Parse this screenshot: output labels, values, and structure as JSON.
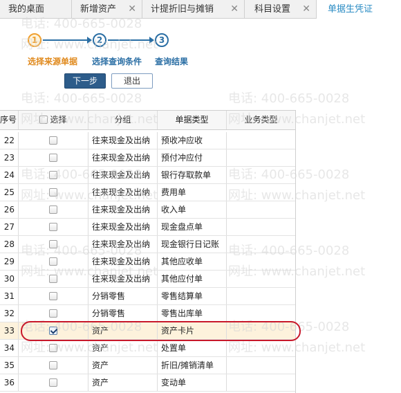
{
  "tabs": [
    {
      "label": "我的桌面",
      "closable": false,
      "active": false
    },
    {
      "label": "新增资产",
      "closable": true,
      "active": false
    },
    {
      "label": "计提折旧与摊销",
      "closable": true,
      "active": false
    },
    {
      "label": "科目设置",
      "closable": true,
      "active": false
    },
    {
      "label": "单据生凭证",
      "closable": false,
      "active": true
    }
  ],
  "close_glyph": "✕",
  "watermark": {
    "phone": "电话: 400-665-0028",
    "site": "网址: www.chanjet.net"
  },
  "wizard": {
    "steps": [
      {
        "number": "1",
        "label": "选择来源单据",
        "active": true
      },
      {
        "number": "2",
        "label": "选择查询条件",
        "active": false
      },
      {
        "number": "3",
        "label": "查询结果",
        "active": false
      }
    ]
  },
  "buttons": {
    "next": "下一步",
    "exit": "退出"
  },
  "grid": {
    "columns": [
      "序号",
      "选择",
      "分组",
      "单据类型",
      "业务类型"
    ],
    "rows": [
      {
        "no": "22",
        "checked": false,
        "group": "往来现金及出纳",
        "type": "预收冲应收",
        "biz": ""
      },
      {
        "no": "23",
        "checked": false,
        "group": "往来现金及出纳",
        "type": "预付冲应付",
        "biz": ""
      },
      {
        "no": "24",
        "checked": false,
        "group": "往来现金及出纳",
        "type": "银行存取款单",
        "biz": ""
      },
      {
        "no": "25",
        "checked": false,
        "group": "往来现金及出纳",
        "type": "费用单",
        "biz": ""
      },
      {
        "no": "26",
        "checked": false,
        "group": "往来现金及出纳",
        "type": "收入单",
        "biz": ""
      },
      {
        "no": "27",
        "checked": false,
        "group": "往来现金及出纳",
        "type": "现金盘点单",
        "biz": ""
      },
      {
        "no": "28",
        "checked": false,
        "group": "往来现金及出纳",
        "type": "现金银行日记账",
        "biz": ""
      },
      {
        "no": "29",
        "checked": false,
        "group": "往来现金及出纳",
        "type": "其他应收单",
        "biz": ""
      },
      {
        "no": "30",
        "checked": false,
        "group": "往来现金及出纳",
        "type": "其他应付单",
        "biz": ""
      },
      {
        "no": "31",
        "checked": false,
        "group": "分销零售",
        "type": "零售结算单",
        "biz": ""
      },
      {
        "no": "32",
        "checked": false,
        "group": "分销零售",
        "type": "零售出库单",
        "biz": ""
      },
      {
        "no": "33",
        "checked": true,
        "group": "资产",
        "type": "资产卡片",
        "biz": ""
      },
      {
        "no": "34",
        "checked": false,
        "group": "资产",
        "type": "处置单",
        "biz": ""
      },
      {
        "no": "35",
        "checked": false,
        "group": "资产",
        "type": "折旧/摊销清单",
        "biz": ""
      },
      {
        "no": "36",
        "checked": false,
        "group": "资产",
        "type": "变动单",
        "biz": ""
      }
    ]
  },
  "colors": {
    "accent_blue": "#2a6ea4",
    "active_step": "#f0a030",
    "highlight_red": "#c8182a",
    "selected_row": "#fdf2dc"
  }
}
